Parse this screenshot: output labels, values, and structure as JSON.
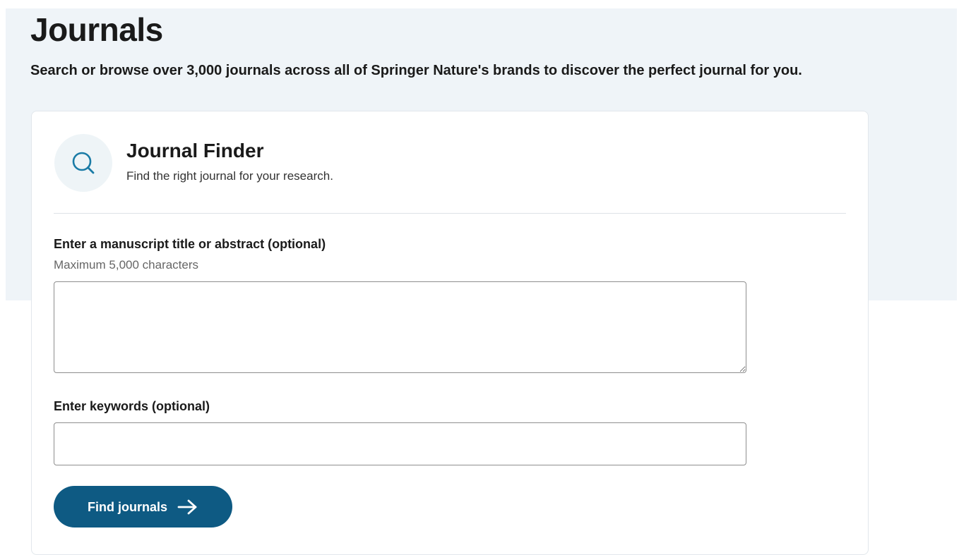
{
  "header": {
    "title": "Journals",
    "subtitle": "Search or browse over 3,000 journals across all of Springer Nature's brands to discover the perfect journal for you."
  },
  "finder": {
    "icon": "search-icon",
    "title": "Journal Finder",
    "description": "Find the right journal for your research.",
    "abstract_field": {
      "label": "Enter a manuscript title or abstract (optional)",
      "hint": "Maximum 5,000 characters",
      "value": ""
    },
    "keywords_field": {
      "label": "Enter keywords (optional)",
      "value": ""
    },
    "submit": {
      "label": "Find journals",
      "icon": "arrow-right-icon"
    }
  },
  "colors": {
    "hero_background": "#eff4f8",
    "button_background": "#0e5a83",
    "icon_accent": "#1a7ba6"
  }
}
